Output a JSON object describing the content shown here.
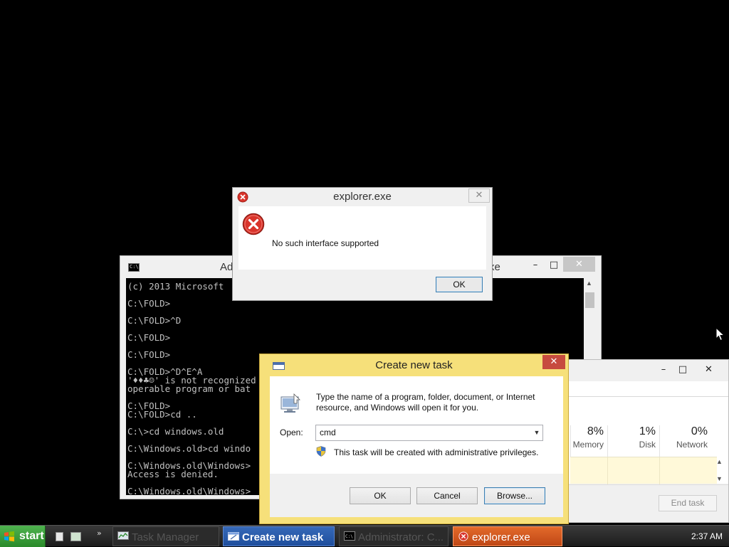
{
  "desktop": {
    "background": "#000000"
  },
  "cmd_window": {
    "title_left": "Ad",
    "title_right": "xe",
    "min_label": "–",
    "max_label": "□",
    "close_label": "✕",
    "lines": [
      "(c) 2013 Microsoft",
      "",
      "C:\\FOLD>",
      "",
      "C:\\FOLD>^D",
      "",
      "C:\\FOLD>",
      "",
      "C:\\FOLD>",
      "",
      "C:\\FOLD>^D^E^A",
      "'♦♦♣☺' is not recognized",
      "operable program or bat",
      "",
      "C:\\FOLD>",
      "C:\\FOLD>cd ..",
      "",
      "C:\\>cd windows.old",
      "",
      "C:\\Windows.old>cd windo",
      "",
      "C:\\Windows.old\\Windows>",
      "Access is denied.",
      "",
      "C:\\Windows.old\\Windows>"
    ]
  },
  "task_manager": {
    "min_label": "–",
    "max_label": "□",
    "close_label": "✕",
    "columns": [
      {
        "pct": "8%",
        "label": "Memory"
      },
      {
        "pct": "1%",
        "label": "Disk"
      },
      {
        "pct": "0%",
        "label": "Network"
      }
    ],
    "end_task": "End task"
  },
  "error_dialog": {
    "title": "explorer.exe",
    "close_label": "✕",
    "message": "No such interface supported",
    "ok_label": "OK"
  },
  "run_dialog": {
    "title": "Create new task",
    "close_label": "✕",
    "description": "Type the name of a program, folder, document, or Internet resource, and Windows will open it for you.",
    "open_label": "Open:",
    "open_value": "cmd",
    "admin_note": "This task will be created with administrative privileges.",
    "ok_label": "OK",
    "cancel_label": "Cancel",
    "browse_label": "Browse..."
  },
  "taskbar": {
    "start_label": "start",
    "chevron": "»",
    "buttons": {
      "task_manager": "Task Manager",
      "create_new_task": "Create new task",
      "administrator": "Administrator: C...",
      "explorer": "explorer.exe"
    },
    "clock": "2:37 AM",
    "colors": {
      "active_button": "#2a5cad",
      "flashing_button": "#d55a20",
      "start_green": "#3c9e3c"
    }
  }
}
